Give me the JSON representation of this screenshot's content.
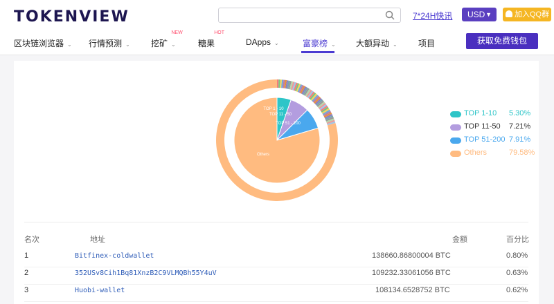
{
  "header": {
    "logo": "TOKENVIEW",
    "search_placeholder": "",
    "news_link": "7*24H快讯",
    "currency": "USD",
    "qq_button": "加入QQ群"
  },
  "nav": {
    "items": [
      {
        "label": "区块链浏览器",
        "caret": "⌄",
        "tag": ""
      },
      {
        "label": "行情预测",
        "caret": "⌄",
        "tag": ""
      },
      {
        "label": "挖矿",
        "caret": "⌄",
        "tag": "NEW"
      },
      {
        "label": "糖果",
        "caret": "",
        "tag": "HOT"
      },
      {
        "label": "DApps",
        "caret": "⌄",
        "tag": ""
      },
      {
        "label": "富豪榜",
        "caret": "⌄",
        "tag": ""
      },
      {
        "label": "大额异动",
        "caret": "⌄",
        "tag": ""
      },
      {
        "label": "项目",
        "caret": "",
        "tag": ""
      }
    ],
    "active_index": 5,
    "cta": "获取免费钱包"
  },
  "chart_data": {
    "type": "pie",
    "categories": [
      "TOP 1-10",
      "TOP 11-50",
      "TOP 51-200",
      "Others"
    ],
    "values": [
      5.3,
      7.21,
      7.91,
      79.58
    ],
    "value_labels": [
      "5.30%",
      "7.21%",
      "7.91%",
      "79.58%"
    ],
    "slice_labels": [
      "TOP 1 - 10",
      "TOP 11 - 50",
      "TOP 51 - 200",
      "Others"
    ],
    "colors": [
      "#2ec5c8",
      "#b39ddf",
      "#4aa8ee",
      "#ffbb80"
    ],
    "outer_ring_color": "#ffbb80",
    "legend_position": "right"
  },
  "table": {
    "headers": {
      "rank": "名次",
      "address": "地址",
      "amount": "金额",
      "percent": "百分比"
    },
    "rows": [
      {
        "rank": "1",
        "address": "Bitfinex-coldwallet",
        "amount": "138660.86800004 BTC",
        "percent": "0.80%"
      },
      {
        "rank": "2",
        "address": "352USv8Cih1Bq81XnzB2C9VLMQBh55Y4uV",
        "amount": "109232.33061056 BTC",
        "percent": "0.63%"
      },
      {
        "rank": "3",
        "address": "Huobi-wallet",
        "amount": "108134.6528752 BTC",
        "percent": "0.62%"
      }
    ]
  }
}
